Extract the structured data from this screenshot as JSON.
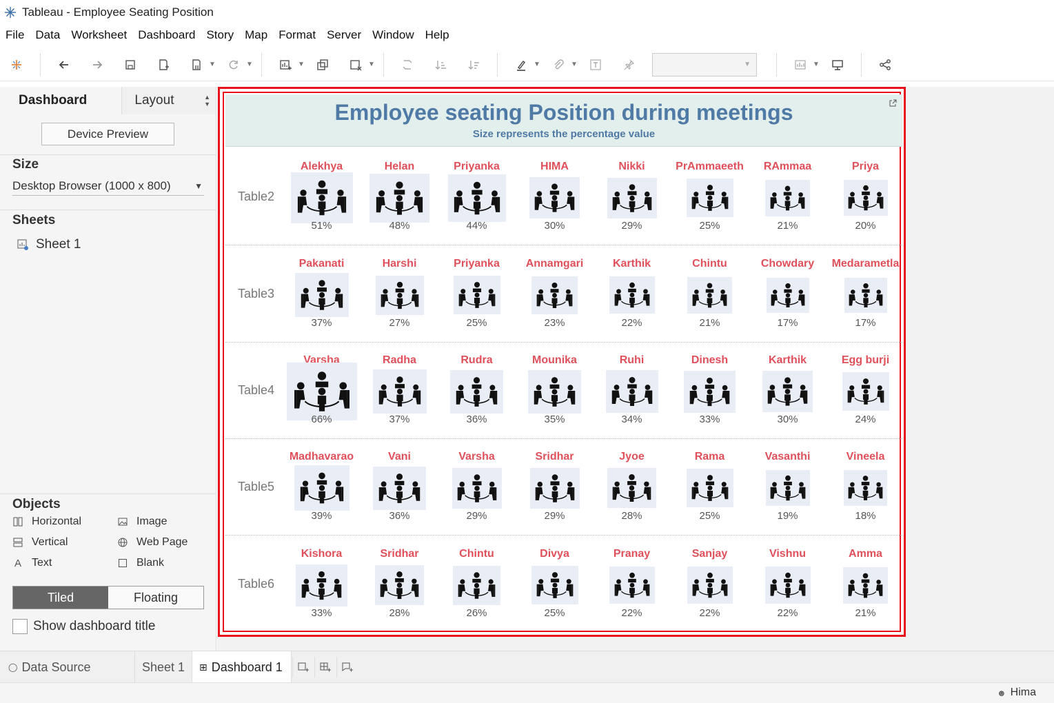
{
  "window": {
    "title": "Tableau - Employee Seating Position"
  },
  "menubar": [
    "File",
    "Data",
    "Worksheet",
    "Dashboard",
    "Story",
    "Map",
    "Format",
    "Server",
    "Window",
    "Help"
  ],
  "left_panel": {
    "tabs": {
      "active": "Dashboard",
      "inactive": "Layout"
    },
    "device_preview": "Device Preview",
    "size_heading": "Size",
    "size_value": "Desktop Browser (1000 x 800)",
    "sheets_heading": "Sheets",
    "sheets": [
      "Sheet 1"
    ],
    "objects_heading": "Objects",
    "objects": {
      "horizontal": "Horizontal",
      "image": "Image",
      "vertical": "Vertical",
      "web_page": "Web Page",
      "text": "Text",
      "blank": "Blank"
    },
    "tiled": "Tiled",
    "floating": "Floating",
    "show_title": "Show dashboard title"
  },
  "dashboard": {
    "title": "Employee seating Position during meetings",
    "subtitle": "Size represents the percentage value",
    "rows": [
      {
        "label": "Table2",
        "cells": [
          {
            "name": "Alekhya",
            "value": 51
          },
          {
            "name": "Helan",
            "value": 48
          },
          {
            "name": "Priyanka",
            "value": 44
          },
          {
            "name": "HIMA",
            "value": 30
          },
          {
            "name": "Nikki",
            "value": 29
          },
          {
            "name": "PrAmmaeeth",
            "value": 25
          },
          {
            "name": "RAmmaa",
            "value": 21
          },
          {
            "name": "Priya",
            "value": 20
          }
        ]
      },
      {
        "label": "Table3",
        "cells": [
          {
            "name": "Pakanati",
            "value": 37
          },
          {
            "name": "Harshi",
            "value": 27
          },
          {
            "name": "Priyanka",
            "value": 25
          },
          {
            "name": "Annamgari",
            "value": 23
          },
          {
            "name": "Karthik",
            "value": 22
          },
          {
            "name": "Chintu",
            "value": 21
          },
          {
            "name": "Chowdary",
            "value": 17
          },
          {
            "name": "Medarametla",
            "value": 17
          }
        ]
      },
      {
        "label": "Table4",
        "cells": [
          {
            "name": "Varsha",
            "value": 66
          },
          {
            "name": "Radha",
            "value": 37
          },
          {
            "name": "Rudra",
            "value": 36
          },
          {
            "name": "Mounika",
            "value": 35
          },
          {
            "name": "Ruhi",
            "value": 34
          },
          {
            "name": "Dinesh",
            "value": 33
          },
          {
            "name": "Karthik",
            "value": 30
          },
          {
            "name": "Egg burji",
            "value": 24
          }
        ]
      },
      {
        "label": "Table5",
        "cells": [
          {
            "name": "Madhavarao",
            "value": 39
          },
          {
            "name": "Vani",
            "value": 36
          },
          {
            "name": "Varsha",
            "value": 29
          },
          {
            "name": "Sridhar",
            "value": 29
          },
          {
            "name": "Jyoe",
            "value": 28
          },
          {
            "name": "Rama",
            "value": 25
          },
          {
            "name": "Vasanthi",
            "value": 19
          },
          {
            "name": "Vineela",
            "value": 18
          }
        ]
      },
      {
        "label": "Table6",
        "cells": [
          {
            "name": "Kishora",
            "value": 33
          },
          {
            "name": "Sridhar",
            "value": 28
          },
          {
            "name": "Chintu",
            "value": 26
          },
          {
            "name": "Divya",
            "value": 25
          },
          {
            "name": "Pranay",
            "value": 22
          },
          {
            "name": "Sanjay",
            "value": 22
          },
          {
            "name": "Vishnu",
            "value": 22
          },
          {
            "name": "Amma",
            "value": 21
          }
        ]
      }
    ],
    "colors": {
      "name": "#e0505a",
      "title": "#4f7aa6",
      "header_bg": "#e3efec",
      "tile_bg": "#e9edf5",
      "border": "#e8101a"
    }
  },
  "bottom_tabs": {
    "data_source": "Data Source",
    "sheet": "Sheet 1",
    "dashboard": "Dashboard 1"
  },
  "status": {
    "user": "Hima"
  }
}
